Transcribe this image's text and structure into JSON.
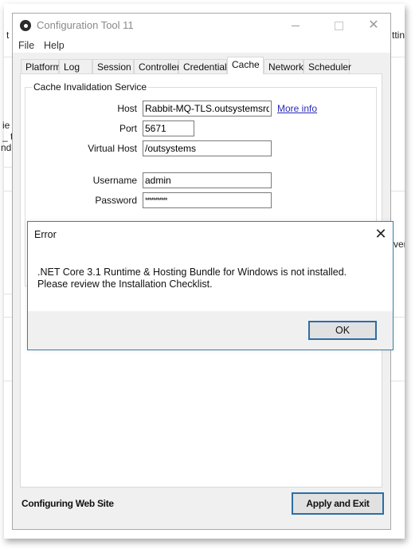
{
  "background": {
    "fragments": [
      {
        "text": "t",
        "name": "bg-fragment-left-1"
      },
      {
        "text": "ttin",
        "name": "bg-fragment-right-1"
      },
      {
        "text": "ie",
        "name": "bg-fragment-left-2"
      },
      {
        "text": "_ t",
        "name": "bg-fragment-left-3"
      },
      {
        "text": "nd",
        "name": "bg-fragment-left-4"
      },
      {
        "text": "ver",
        "name": "bg-fragment-right-2"
      }
    ]
  },
  "window": {
    "title": "Configuration Tool 11",
    "icon": "app-logo-icon",
    "controls": {
      "minimize": "minimize-icon",
      "maximize": "maximize-icon",
      "close_glyph": "✕"
    }
  },
  "menu": {
    "items": [
      "File",
      "Help"
    ]
  },
  "tabs": {
    "items": [
      "Platform",
      "Log",
      "Session",
      "Controller",
      "Credentials",
      "Cache",
      "Network",
      "Scheduler"
    ],
    "active": "Cache"
  },
  "cache_panel": {
    "group_title": "Cache Invalidation Service",
    "fields": {
      "host": {
        "label": "Host",
        "value": "Rabbit-MQ-TLS.outsystemsrd.net"
      },
      "port": {
        "label": "Port",
        "value": "5671"
      },
      "virtual_host": {
        "label": "Virtual Host",
        "value": "/outsystems"
      },
      "username": {
        "label": "Username",
        "value": "admin"
      },
      "password": {
        "label": "Password",
        "value": "***********"
      }
    },
    "more_info_link": "More info"
  },
  "status": {
    "text": "Configuring Web Site"
  },
  "footer": {
    "apply_label": "Apply and Exit"
  },
  "error_dialog": {
    "title": "Error",
    "close_glyph": "✕",
    "message": ".NET Core 3.1 Runtime & Hosting Bundle for Windows is not installed. Please review the Installation Checklist.",
    "ok_label": "OK"
  },
  "colors": {
    "accent_border": "#2b6ea6",
    "link": "#2a2ab8",
    "client_bg": "#f0f0f0"
  }
}
